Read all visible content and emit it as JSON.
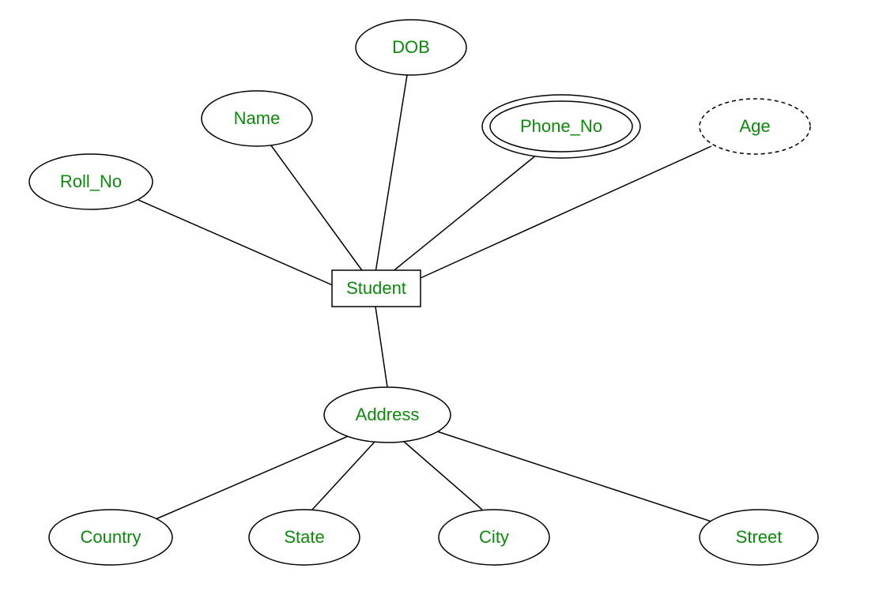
{
  "diagram": {
    "type": "er-diagram",
    "entity": {
      "label": "Student",
      "shape": "rectangle"
    },
    "attributes": [
      {
        "id": "roll_no",
        "label": "Roll_No",
        "shape": "ellipse",
        "style": "solid"
      },
      {
        "id": "name",
        "label": "Name",
        "shape": "ellipse",
        "style": "solid"
      },
      {
        "id": "dob",
        "label": "DOB",
        "shape": "ellipse",
        "style": "solid"
      },
      {
        "id": "phone_no",
        "label": "Phone_No",
        "shape": "double-ellipse",
        "style": "multivalued"
      },
      {
        "id": "age",
        "label": "Age",
        "shape": "ellipse",
        "style": "dashed-derived"
      },
      {
        "id": "address",
        "label": "Address",
        "shape": "ellipse",
        "style": "solid",
        "composite": true
      }
    ],
    "address_sub_attributes": [
      {
        "id": "country",
        "label": "Country",
        "shape": "ellipse",
        "style": "solid"
      },
      {
        "id": "state",
        "label": "State",
        "shape": "ellipse",
        "style": "solid"
      },
      {
        "id": "city",
        "label": "City",
        "shape": "ellipse",
        "style": "solid"
      },
      {
        "id": "street",
        "label": "Street",
        "shape": "ellipse",
        "style": "solid"
      }
    ],
    "edges": [
      {
        "from": "student",
        "to": "roll_no"
      },
      {
        "from": "student",
        "to": "name"
      },
      {
        "from": "student",
        "to": "dob"
      },
      {
        "from": "student",
        "to": "phone_no"
      },
      {
        "from": "student",
        "to": "age"
      },
      {
        "from": "student",
        "to": "address"
      },
      {
        "from": "address",
        "to": "country"
      },
      {
        "from": "address",
        "to": "state"
      },
      {
        "from": "address",
        "to": "city"
      },
      {
        "from": "address",
        "to": "street"
      }
    ]
  }
}
